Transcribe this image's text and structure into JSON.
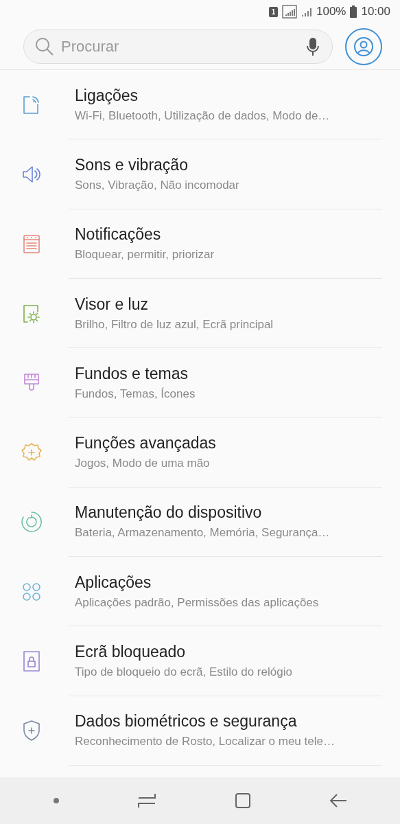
{
  "status_bar": {
    "sim": "1",
    "battery_text": "100%",
    "time": "10:00"
  },
  "search": {
    "placeholder": "Procurar"
  },
  "items": [
    {
      "kind": "connections",
      "title": "Ligações",
      "subtitle": "Wi-Fi, Bluetooth, Utilização de dados, Modo de…"
    },
    {
      "kind": "sound",
      "title": "Sons e vibração",
      "subtitle": "Sons, Vibração, Não incomodar"
    },
    {
      "kind": "notifications",
      "title": "Notificações",
      "subtitle": "Bloquear, permitir, priorizar"
    },
    {
      "kind": "display",
      "title": "Visor e luz",
      "subtitle": "Brilho, Filtro de luz azul, Ecrã principal"
    },
    {
      "kind": "brush",
      "title": "Fundos e temas",
      "subtitle": "Fundos, Temas, Ícones"
    },
    {
      "kind": "advanced",
      "title": "Funções avançadas",
      "subtitle": "Jogos, Modo de uma mão"
    },
    {
      "kind": "maintenance",
      "title": "Manutenção do dispositivo",
      "subtitle": "Bateria, Armazenamento, Memória, Segurança…"
    },
    {
      "kind": "apps",
      "title": "Aplicações",
      "subtitle": "Aplicações padrão, Permissões das aplicações"
    },
    {
      "kind": "lock",
      "title": "Ecrã bloqueado",
      "subtitle": "Tipo de bloqueio do ecrã, Estilo do relógio"
    },
    {
      "kind": "security",
      "title": "Dados biométricos e segurança",
      "subtitle": "Reconhecimento de Rosto, Localizar o meu tele…"
    }
  ]
}
